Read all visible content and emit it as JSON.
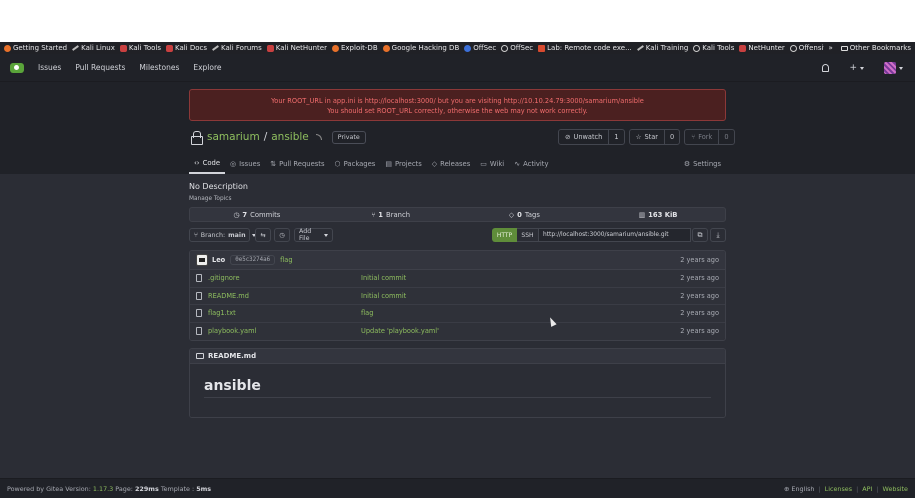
{
  "bookmarks": [
    {
      "label": "Getting Started",
      "icon": "firefox-icon"
    },
    {
      "label": "Kali Linux",
      "icon": "kali-icon"
    },
    {
      "label": "Kali Tools",
      "icon": "kali-tools-icon"
    },
    {
      "label": "Kali Docs",
      "icon": "kali-tools-icon"
    },
    {
      "label": "Kali Forums",
      "icon": "kali-icon"
    },
    {
      "label": "Kali NetHunter",
      "icon": "kali-tools-icon"
    },
    {
      "label": "Exploit-DB",
      "icon": "exploit-db-icon"
    },
    {
      "label": "Google Hacking DB",
      "icon": "exploit-db-icon"
    },
    {
      "label": "OffSec",
      "icon": "offsec-icon"
    },
    {
      "label": "OffSec",
      "icon": "globe-icon"
    },
    {
      "label": "Lab: Remote code exe...",
      "icon": "portswigger-icon"
    },
    {
      "label": "Kali Training",
      "icon": "kali-icon"
    },
    {
      "label": "Kali Tools",
      "icon": "globe-icon"
    },
    {
      "label": "NetHunter",
      "icon": "kali-tools-icon"
    },
    {
      "label": "Offensive Security",
      "icon": "globe-icon"
    }
  ],
  "bookmarks_overflow": "»",
  "other_bookmarks": "Other Bookmarks",
  "nav": {
    "issues": "Issues",
    "pulls": "Pull Requests",
    "milestones": "Milestones",
    "explore": "Explore",
    "plus": "+"
  },
  "flash": {
    "line1": "Your ROOT_URL in app.ini is http://localhost:3000/ but you are visiting http://10.10.24.79:3000/samarium/ansible",
    "line2": "You should set ROOT_URL correctly, otherwise the web may not work correctly."
  },
  "repo": {
    "owner": "samarium",
    "slash": "/",
    "name": "ansible",
    "visibility": "Private"
  },
  "actions": {
    "unwatch": "Unwatch",
    "watch_count": "1",
    "star": "Star",
    "star_count": "0",
    "fork": "Fork",
    "fork_count": "0"
  },
  "tabs": {
    "code": "Code",
    "issues": "Issues",
    "pulls": "Pull Requests",
    "packages": "Packages",
    "projects": "Projects",
    "releases": "Releases",
    "wiki": "Wiki",
    "activity": "Activity",
    "settings": "Settings"
  },
  "description": "No Description",
  "manage_topics": "Manage Topics",
  "stats": {
    "commits_n": "7",
    "commits": "Commits",
    "branch_n": "1",
    "branch": "Branch",
    "tags_n": "0",
    "tags": "Tags",
    "size": "163 KiB"
  },
  "toolbar": {
    "branch_label": "Branch:",
    "branch": "main",
    "add_file": "Add File"
  },
  "clone": {
    "http": "HTTP",
    "ssh": "SSH",
    "url": "http://localhost:3000/samarium/ansible.git"
  },
  "latest_commit": {
    "author": "Leo",
    "sha": "0e5c3274a6",
    "message": "flag",
    "time": "2 years ago"
  },
  "files": [
    {
      "name": ".gitignore",
      "message": "Initial commit",
      "time": "2 years ago"
    },
    {
      "name": "README.md",
      "message": "Initial commit",
      "time": "2 years ago"
    },
    {
      "name": "flag1.txt",
      "message": "flag",
      "time": "2 years ago"
    },
    {
      "name": "playbook.yaml",
      "message": "Update 'playbook.yaml'",
      "time": "2 years ago"
    }
  ],
  "readme": {
    "file": "README.md",
    "heading": "ansible"
  },
  "footer": {
    "powered": "Powered by Gitea",
    "version_label": "Version:",
    "version": "1.17.3",
    "page_label": "Page:",
    "page_time": "229ms",
    "template_label": "Template :",
    "template_time": "5ms",
    "language": "English",
    "licenses": "Licenses",
    "api": "API",
    "website": "Website"
  }
}
